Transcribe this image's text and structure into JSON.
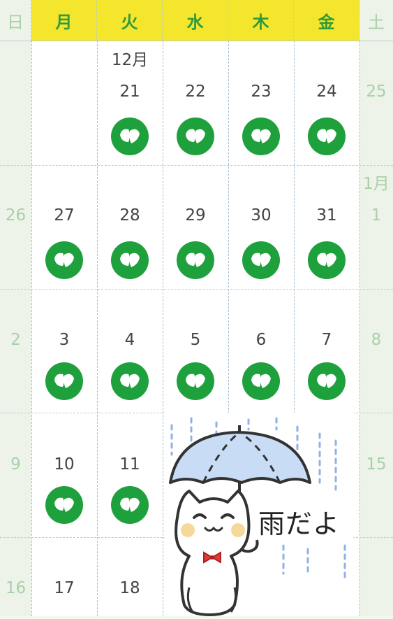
{
  "header": {
    "days": [
      "日",
      "月",
      "火",
      "水",
      "木",
      "金",
      "土"
    ]
  },
  "months": {
    "dec_label": "12月",
    "jan_label": "1月"
  },
  "weeks": [
    {
      "sun": "",
      "sat": "25",
      "weekdays": [
        "",
        "21",
        "22",
        "23",
        "24"
      ],
      "stamps": [
        false,
        true,
        true,
        true,
        true
      ]
    },
    {
      "sun": "26",
      "sat": "1",
      "weekdays": [
        "27",
        "28",
        "29",
        "30",
        "31"
      ],
      "stamps": [
        true,
        true,
        true,
        true,
        true
      ]
    },
    {
      "sun": "2",
      "sat": "8",
      "weekdays": [
        "3",
        "4",
        "5",
        "6",
        "7"
      ],
      "stamps": [
        true,
        true,
        true,
        true,
        true
      ]
    },
    {
      "sun": "9",
      "sat": "15",
      "weekdays": [
        "10",
        "11",
        "",
        "",
        ""
      ],
      "stamps": [
        true,
        true,
        false,
        false,
        false
      ]
    },
    {
      "sun": "16",
      "sat": "",
      "weekdays": [
        "17",
        "18",
        "",
        "",
        ""
      ],
      "stamps": [
        false,
        false,
        false,
        false,
        false
      ]
    }
  ],
  "sticker": {
    "text": "雨だよ",
    "icon": "cat-with-umbrella-sticker"
  },
  "colors": {
    "header_weekday_bg": "#f4e62d",
    "header_weekday_text": "#2f9a3a",
    "weekend_text": "#a9cfa8",
    "stamp_green": "#1ea13c"
  }
}
